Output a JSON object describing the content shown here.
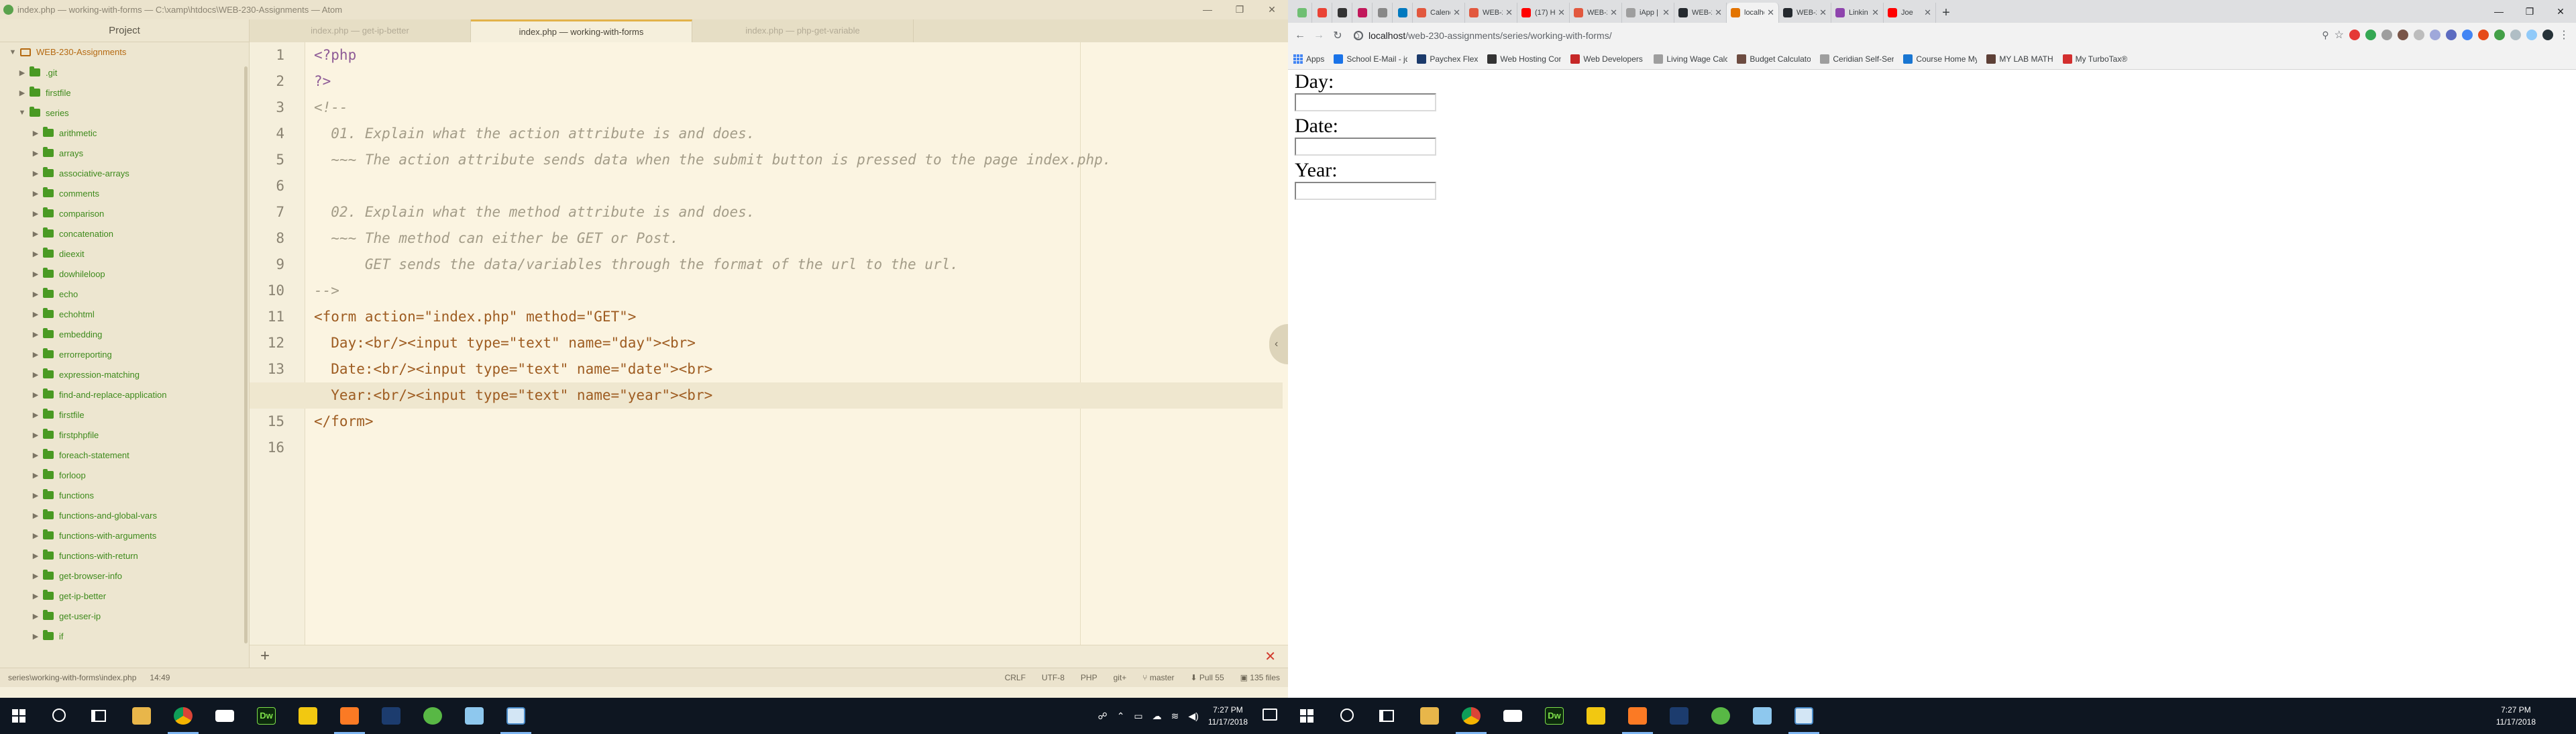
{
  "atom": {
    "window_title": "index.php — working-with-forms — C:\\xamp\\htdocs\\WEB-230-Assignments — Atom",
    "window_controls": [
      "—",
      "❐",
      "✕"
    ],
    "tree_view": {
      "header": "Project",
      "root": "WEB-230-Assignments",
      "items": [
        {
          "label": ".git",
          "level": 1,
          "expanded": false
        },
        {
          "label": "firstfile",
          "level": 1,
          "expanded": false
        },
        {
          "label": "series",
          "level": 1,
          "expanded": true
        },
        {
          "label": "arithmetic",
          "level": 2
        },
        {
          "label": "arrays",
          "level": 2
        },
        {
          "label": "associative-arrays",
          "level": 2
        },
        {
          "label": "comments",
          "level": 2
        },
        {
          "label": "comparison",
          "level": 2
        },
        {
          "label": "concatenation",
          "level": 2
        },
        {
          "label": "dieexit",
          "level": 2
        },
        {
          "label": "dowhileloop",
          "level": 2
        },
        {
          "label": "echo",
          "level": 2
        },
        {
          "label": "echohtml",
          "level": 2
        },
        {
          "label": "embedding",
          "level": 2
        },
        {
          "label": "errorreporting",
          "level": 2
        },
        {
          "label": "expression-matching",
          "level": 2
        },
        {
          "label": "find-and-replace-application",
          "level": 2
        },
        {
          "label": "firstfile",
          "level": 2
        },
        {
          "label": "firstphpfile",
          "level": 2
        },
        {
          "label": "foreach-statement",
          "level": 2
        },
        {
          "label": "forloop",
          "level": 2
        },
        {
          "label": "functions",
          "level": 2
        },
        {
          "label": "functions-and-global-vars",
          "level": 2
        },
        {
          "label": "functions-with-arguments",
          "level": 2
        },
        {
          "label": "functions-with-return",
          "level": 2
        },
        {
          "label": "get-browser-info",
          "level": 2
        },
        {
          "label": "get-ip-better",
          "level": 2
        },
        {
          "label": "get-user-ip",
          "level": 2
        },
        {
          "label": "if",
          "level": 2
        }
      ]
    },
    "tabs": [
      {
        "label": "index.php — get-ip-better",
        "active": false
      },
      {
        "label": "index.php — working-with-forms",
        "active": true
      },
      {
        "label": "index.php — php-get-variable",
        "active": false
      }
    ],
    "editor": {
      "line_numbers": [
        "1",
        "2",
        "3",
        "4",
        "5",
        "6",
        "7",
        "8",
        "9",
        "10",
        "11",
        "12",
        "13",
        "14",
        "15",
        "16"
      ],
      "current_line": 14,
      "lines": [
        "<?php",
        "?>",
        "<!--",
        "  01. Explain what the action attribute is and does.",
        "  ~~~ The action attribute sends data when the submit button is pressed to the page index.php.",
        "",
        "  02. Explain what the method attribute is and does.",
        "  ~~~ The method can either be GET or Post.",
        "      GET sends the data/variables through the format of the url to the url.",
        "-->",
        "<form action=\"index.php\" method=\"GET\">",
        "  Day:<br/><input type=\"text\" name=\"day\"><br>",
        "  Date:<br/><input type=\"text\" name=\"date\"><br>",
        "  Year:<br/><input type=\"text\" name=\"year\"><br>",
        "</form>",
        ""
      ]
    },
    "status": {
      "path": "series\\working-with-forms\\index.php",
      "cursor": "14:49",
      "line_ending": "CRLF",
      "encoding": "UTF-8",
      "grammar": "PHP",
      "git": "git+",
      "branch": "master",
      "pull": "Pull 55",
      "files": "135 files"
    }
  },
  "taskbar_left": {
    "clock_time": "7:27 PM",
    "clock_date": "11/17/2018"
  },
  "chrome": {
    "tabs": [
      {
        "title": "",
        "pinned": true,
        "color": "#6fbf73"
      },
      {
        "title": "",
        "pinned": true,
        "color": "#ea4335"
      },
      {
        "title": "",
        "pinned": true,
        "color": "#333333"
      },
      {
        "title": "",
        "pinned": true,
        "color": "#c2185b"
      },
      {
        "title": "",
        "pinned": true,
        "color": "#888888"
      },
      {
        "title": "",
        "pinned": true,
        "color": "#0079bf"
      },
      {
        "title": "Calendar",
        "pinned": false,
        "color": "#e2583e"
      },
      {
        "title": "WEB-23",
        "pinned": false,
        "color": "#e2583e"
      },
      {
        "title": "(17) How",
        "pinned": false,
        "color": "#ff0000"
      },
      {
        "title": "WEB-23",
        "pinned": false,
        "color": "#e2583e"
      },
      {
        "title": "iApp | I",
        "pinned": false,
        "color": "#9e9e9e"
      },
      {
        "title": "WEB-23",
        "pinned": false,
        "color": "#24292e"
      },
      {
        "title": "localhost",
        "pinned": false,
        "color": "#e37400",
        "active": true
      },
      {
        "title": "WEB-23",
        "pinned": false,
        "color": "#24292e"
      },
      {
        "title": "Linkin P",
        "pinned": false,
        "color": "#8e44ad"
      },
      {
        "title": "Joe",
        "pinned": false,
        "color": "#ff0000"
      }
    ],
    "new_tab": "+",
    "window_controls": [
      "—",
      "❐",
      "✕"
    ],
    "url_host": "localhost",
    "url_path": "/web-230-assignments/series/working-with-forms/",
    "bookmarks": [
      {
        "label": "Apps",
        "color": "#4285f4"
      },
      {
        "label": "School E-Mail - jdeye",
        "color": "#1a73e8"
      },
      {
        "label": "Paychex Flex",
        "color": "#1b3a6b"
      },
      {
        "label": "Web Hosting Contro",
        "color": "#333333"
      },
      {
        "label": "Web Developers : Do",
        "color": "#c62828"
      },
      {
        "label": "Living Wage Calculat",
        "color": "#9e9e9e"
      },
      {
        "label": "Budget Calculator - Y",
        "color": "#6d4c41"
      },
      {
        "label": "Ceridian Self-Service",
        "color": "#9e9e9e"
      },
      {
        "label": "Course Home My Lat",
        "color": "#1976d2"
      },
      {
        "label": "MY LAB MATH",
        "color": "#5d4037"
      },
      {
        "label": "My TurboTax®",
        "color": "#d32f2f"
      }
    ]
  },
  "page": {
    "fields": [
      {
        "label": "Day:",
        "value": ""
      },
      {
        "label": "Date:",
        "value": ""
      },
      {
        "label": "Year:",
        "value": ""
      }
    ]
  },
  "taskbar_right": {
    "clock_time": "7:27 PM",
    "clock_date": "11/17/2018"
  }
}
